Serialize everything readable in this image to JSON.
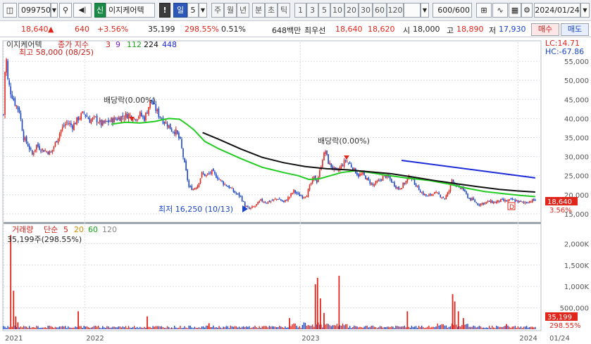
{
  "toolbar": {
    "code": "099750",
    "credit_tag": "신",
    "stock_name": "이지케어텍",
    "alert": "!",
    "periods": [
      "일",
      "주",
      "월",
      "년",
      "분",
      "초",
      "틱"
    ],
    "active_period": "일",
    "period_count": "5",
    "minute_options": [
      "1",
      "3",
      "5",
      "10",
      "20",
      "30",
      "60",
      "120"
    ],
    "count": "600",
    "count_total": "/600",
    "date": "2024/01/24"
  },
  "quote": {
    "price": "18,640",
    "change_arrow": "▲",
    "change": "640",
    "change_pct": "+3.56%",
    "volume": "35,199",
    "volume_ratio": "298.55%",
    "turnover": "0.51%",
    "amount": "648백만",
    "best_label": "최우선",
    "ask": "18,640",
    "bid": "18,620",
    "open_label": "시",
    "open": "18,000",
    "high_label": "고",
    "high": "18,890",
    "low_label": "저",
    "low": "17,930",
    "buy": "매수",
    "sell": "매도"
  },
  "price_panel": {
    "legend_name": "이지케어텍",
    "legend_prefix": "종가 지수",
    "ma_periods": [
      "3",
      "9",
      "112",
      "224",
      "448"
    ],
    "high_note": "최고 58,000 (08/25)",
    "low_note": "최저 16,250 (10/13)",
    "dividend_1": "배당락(0.00%)",
    "dividend_2": "배당락(0.00%)",
    "lc": "LC:14.71",
    "hc": "HC:-67.86",
    "last_price": "18,640",
    "last_pct": "3.56%",
    "d_marker": "D"
  },
  "volume_panel": {
    "legend_name": "거래량",
    "legend_prefix": "단순",
    "ma_periods": [
      "5",
      "20",
      "60",
      "120"
    ],
    "last_note": "35,199주(298.55%)",
    "last_value": "35,199",
    "last_pct": "298.55%"
  },
  "colors": {
    "up": "#e0251b",
    "down": "#1a45c9",
    "ma112": "#22cc22",
    "ma224": "#111111",
    "trend": "#1c2bd8"
  },
  "chart_data": {
    "type": "candlestick",
    "price_axis": {
      "ticks": [
        15000,
        20000,
        25000,
        30000,
        35000,
        40000,
        45000,
        50000,
        55000
      ],
      "labels": [
        "15,000",
        "20,000",
        "25,000",
        "30,000",
        "35,000",
        "40,000",
        "45,000",
        "50,000",
        "55,000"
      ],
      "ylim": [
        13500,
        60000
      ]
    },
    "volume_axis": {
      "ticks": [
        500000,
        1000000,
        1500000,
        2000000
      ],
      "labels": [
        "500,000",
        "1,000K",
        "1,500K",
        "2,000K"
      ],
      "ylim": [
        0,
        2400000
      ]
    },
    "x_labels": [
      "2021",
      "2022",
      "2023",
      "2024",
      "01/24"
    ],
    "close_path": [
      [
        0,
        41000
      ],
      [
        3,
        58000
      ],
      [
        6,
        50000
      ],
      [
        10,
        47000
      ],
      [
        16,
        44000
      ],
      [
        22,
        42000
      ],
      [
        28,
        35000
      ],
      [
        34,
        33000
      ],
      [
        40,
        30500
      ],
      [
        46,
        33000
      ],
      [
        52,
        32000
      ],
      [
        58,
        31500
      ],
      [
        66,
        31000
      ],
      [
        72,
        33500
      ],
      [
        80,
        37000
      ],
      [
        88,
        39000
      ],
      [
        96,
        38000
      ],
      [
        104,
        40000
      ],
      [
        112,
        41500
      ],
      [
        120,
        39500
      ],
      [
        128,
        40000
      ],
      [
        136,
        38500
      ],
      [
        144,
        39000
      ],
      [
        150,
        39500
      ],
      [
        158,
        40000
      ],
      [
        166,
        40500
      ],
      [
        174,
        41000
      ],
      [
        182,
        40000
      ],
      [
        190,
        41000
      ],
      [
        196,
        40000
      ],
      [
        200,
        42000
      ],
      [
        205,
        45000
      ],
      [
        210,
        43000
      ],
      [
        216,
        41000
      ],
      [
        222,
        39500
      ],
      [
        228,
        38500
      ],
      [
        234,
        37000
      ],
      [
        240,
        36500
      ],
      [
        246,
        34000
      ],
      [
        252,
        28000
      ],
      [
        258,
        22000
      ],
      [
        264,
        21500
      ],
      [
        270,
        22500
      ],
      [
        276,
        25500
      ],
      [
        282,
        25000
      ],
      [
        290,
        26000
      ],
      [
        298,
        24500
      ],
      [
        306,
        23000
      ],
      [
        314,
        22000
      ],
      [
        322,
        20500
      ],
      [
        330,
        19500
      ],
      [
        336,
        17000
      ],
      [
        342,
        16250
      ],
      [
        350,
        17000
      ],
      [
        358,
        18500
      ],
      [
        366,
        18000
      ],
      [
        374,
        18500
      ],
      [
        382,
        19000
      ],
      [
        390,
        18000
      ],
      [
        398,
        19500
      ],
      [
        404,
        21000
      ],
      [
        410,
        20000
      ],
      [
        416,
        19500
      ],
      [
        422,
        20000
      ],
      [
        428,
        23000
      ],
      [
        432,
        24500
      ],
      [
        436,
        23500
      ],
      [
        440,
        26000
      ],
      [
        444,
        29500
      ],
      [
        448,
        31500
      ],
      [
        452,
        28500
      ],
      [
        458,
        27000
      ],
      [
        464,
        26000
      ],
      [
        470,
        27500
      ],
      [
        476,
        29000
      ],
      [
        482,
        28000
      ],
      [
        488,
        26500
      ],
      [
        494,
        25000
      ],
      [
        500,
        25500
      ],
      [
        506,
        24000
      ],
      [
        514,
        22500
      ],
      [
        522,
        23500
      ],
      [
        530,
        25000
      ],
      [
        536,
        24500
      ],
      [
        542,
        23000
      ],
      [
        550,
        21500
      ],
      [
        558,
        23000
      ],
      [
        566,
        25000
      ],
      [
        574,
        22500
      ],
      [
        582,
        20500
      ],
      [
        590,
        19500
      ],
      [
        598,
        20500
      ],
      [
        606,
        20000
      ],
      [
        614,
        19000
      ],
      [
        620,
        21000
      ],
      [
        624,
        24000
      ],
      [
        628,
        23000
      ],
      [
        634,
        21500
      ],
      [
        638,
        22000
      ],
      [
        642,
        20500
      ],
      [
        648,
        19000
      ],
      [
        654,
        18500
      ],
      [
        660,
        17500
      ],
      [
        668,
        17800
      ],
      [
        676,
        18200
      ],
      [
        684,
        18000
      ],
      [
        692,
        18500
      ],
      [
        700,
        18300
      ],
      [
        708,
        18700
      ],
      [
        716,
        18200
      ],
      [
        724,
        17900
      ],
      [
        732,
        18300
      ],
      [
        740,
        18640
      ]
    ],
    "ma112": [
      [
        150,
        38500
      ],
      [
        170,
        39000
      ],
      [
        190,
        38800
      ],
      [
        210,
        39200
      ],
      [
        230,
        40000
      ],
      [
        245,
        39800
      ],
      [
        255,
        38500
      ],
      [
        265,
        37000
      ],
      [
        280,
        34000
      ],
      [
        300,
        32000
      ],
      [
        330,
        29500
      ],
      [
        360,
        27200
      ],
      [
        390,
        25800
      ],
      [
        410,
        25000
      ],
      [
        425,
        24000
      ],
      [
        440,
        24200
      ],
      [
        455,
        25000
      ],
      [
        470,
        25800
      ],
      [
        490,
        26300
      ],
      [
        510,
        25800
      ],
      [
        530,
        25200
      ],
      [
        560,
        24400
      ],
      [
        590,
        23800
      ],
      [
        620,
        22800
      ],
      [
        645,
        21700
      ],
      [
        670,
        20800
      ],
      [
        700,
        20200
      ],
      [
        720,
        19800
      ],
      [
        740,
        19500
      ]
    ],
    "ma224": [
      [
        277,
        36300
      ],
      [
        300,
        34500
      ],
      [
        330,
        32000
      ],
      [
        360,
        29800
      ],
      [
        390,
        28400
      ],
      [
        420,
        27400
      ],
      [
        450,
        26800
      ],
      [
        480,
        26500
      ],
      [
        510,
        26000
      ],
      [
        540,
        25500
      ],
      [
        570,
        24600
      ],
      [
        600,
        23700
      ],
      [
        630,
        22900
      ],
      [
        660,
        22100
      ],
      [
        690,
        21400
      ],
      [
        715,
        21000
      ],
      [
        740,
        20700
      ]
    ],
    "trend_line": [
      [
        554,
        29000
      ],
      [
        740,
        24400
      ]
    ],
    "volume_spikes": [
      [
        10,
        2200000
      ],
      [
        14,
        900000
      ],
      [
        17,
        300000
      ],
      [
        20,
        160000
      ],
      [
        104,
        420000
      ],
      [
        200,
        300000
      ],
      [
        286,
        140000
      ],
      [
        398,
        260000
      ],
      [
        434,
        1050000
      ],
      [
        437,
        1200000
      ],
      [
        441,
        720000
      ],
      [
        446,
        380000
      ],
      [
        467,
        1250000
      ],
      [
        562,
        420000
      ],
      [
        625,
        820000
      ],
      [
        628,
        650000
      ],
      [
        633,
        420000
      ],
      [
        640,
        260000
      ],
      [
        700,
        120000
      ],
      [
        736,
        35199
      ]
    ]
  }
}
